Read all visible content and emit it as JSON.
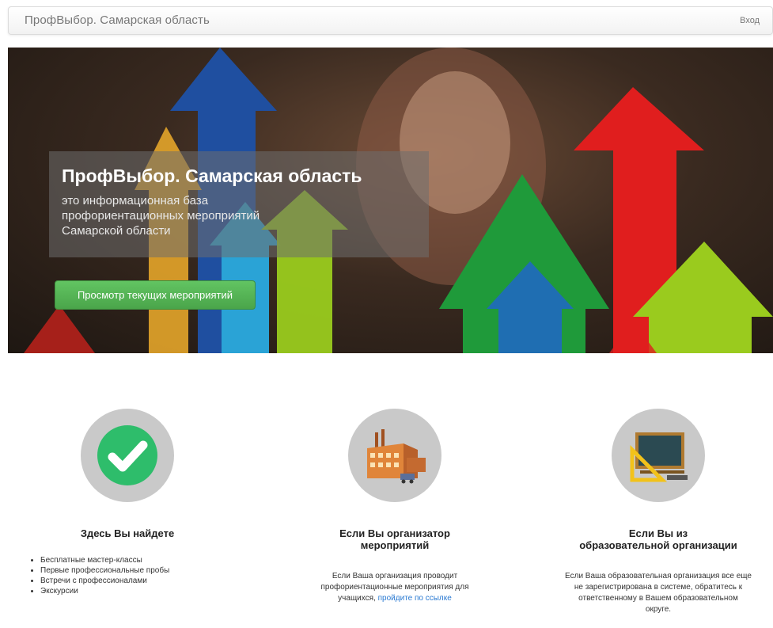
{
  "navbar": {
    "brand": "ПрофВыбор. Самарская область",
    "login": "Вход"
  },
  "hero": {
    "title": "ПрофВыбор. Самарская область",
    "subtitle": "это информационная база профориентационных мероприятий Самарской области",
    "button": "Просмотр текущих мероприятий"
  },
  "features": [
    {
      "icon": "checkmark-icon",
      "title": "Здесь Вы найдете",
      "items": [
        "Бесплатные мастер-классы",
        "Первые профессиональные пробы",
        "Встречи с профессионалами",
        "Экскурсии"
      ]
    },
    {
      "icon": "factory-icon",
      "title_line1": "Если Вы организатор",
      "title_line2": "мероприятий",
      "text": "Если Ваша организация проводит профориентационные мероприятия для учащихся,",
      "link": "пройдите по ссылке"
    },
    {
      "icon": "chalkboard-icon",
      "title_line1": "Если Вы из",
      "title_line2": "образовательной организации",
      "text": "Если Ваша образовательная организация все еще не зарегистрирована в системе, обратитесь к ответственному в Вашем образовательном округе."
    }
  ]
}
